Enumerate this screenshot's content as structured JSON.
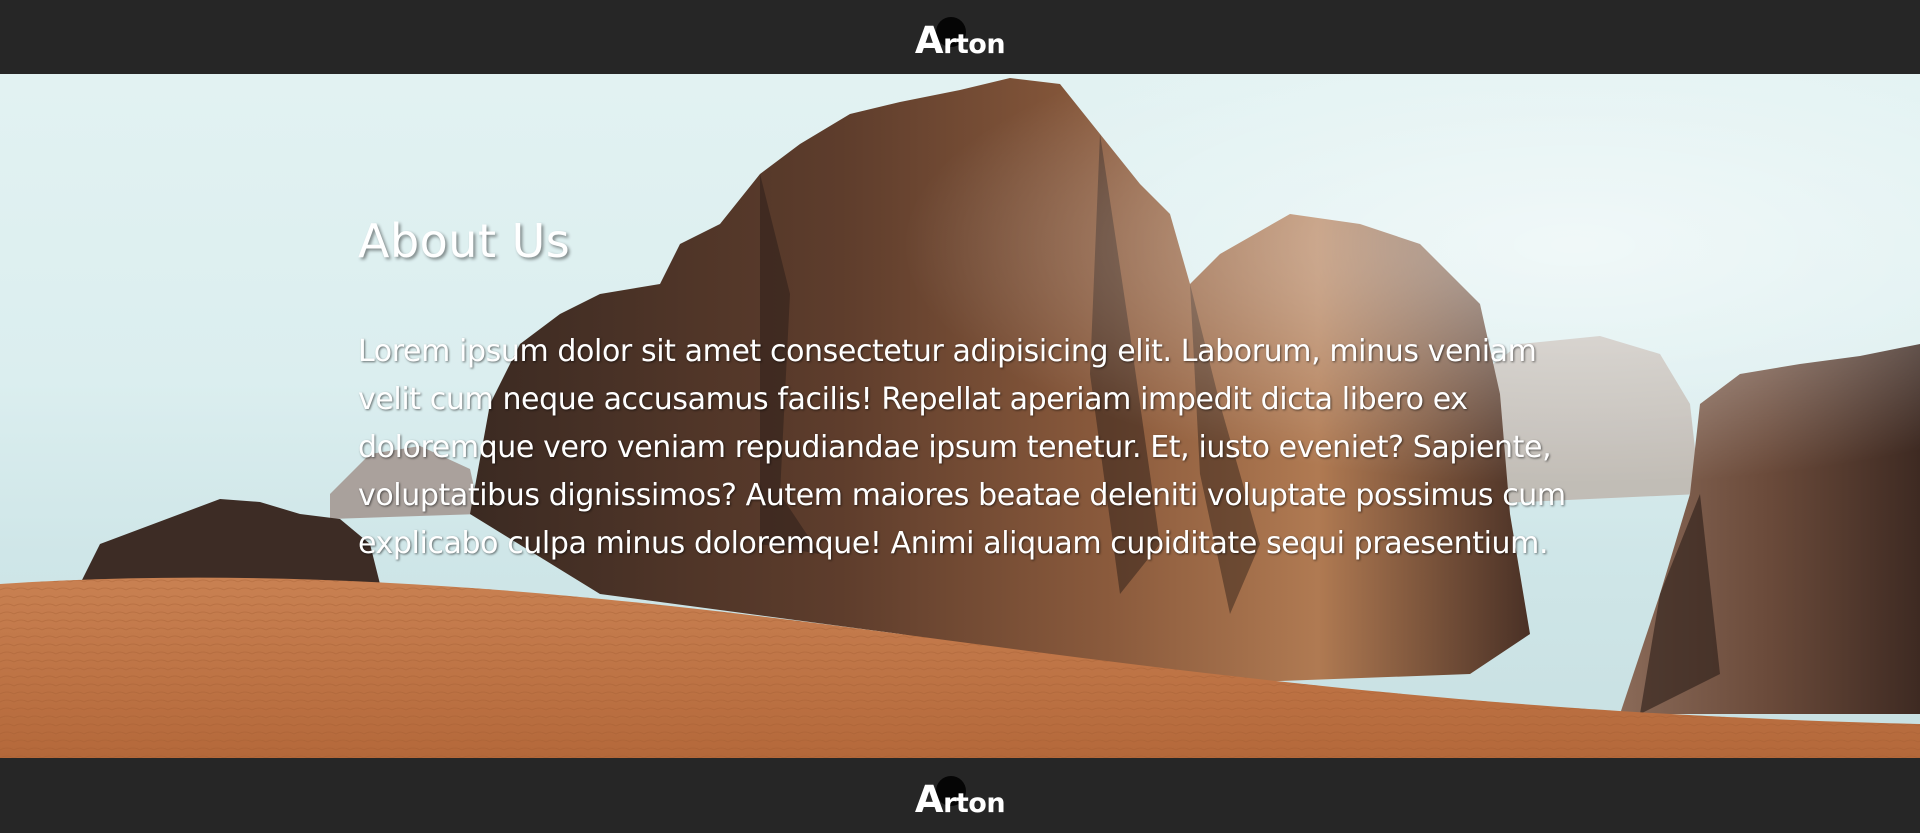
{
  "header": {
    "logo_initial": "A",
    "logo_rest": "rton"
  },
  "about": {
    "heading": "About Us",
    "body": "Lorem ipsum dolor sit amet consectetur adipisicing elit. Laborum, minus veniam velit cum neque accusamus facilis! Repellat aperiam impedit dicta libero ex doloremque vero veniam repudiandae ipsum tenetur. Et, iusto eveniet? Sapiente, voluptatibus dignissimos? Autem maiores beatae deleniti voluptate possimus cum explicabo culpa minus doloremque! Animi aliquam cupiditate sequi praesentium."
  },
  "footer": {
    "logo_initial": "A",
    "logo_rest": "rton"
  },
  "colors": {
    "bar_background": "#262626",
    "text": "#ffffff",
    "sand": "#c27a45",
    "rock": "#6a4332"
  },
  "hero_image": "desert-rocks-background"
}
